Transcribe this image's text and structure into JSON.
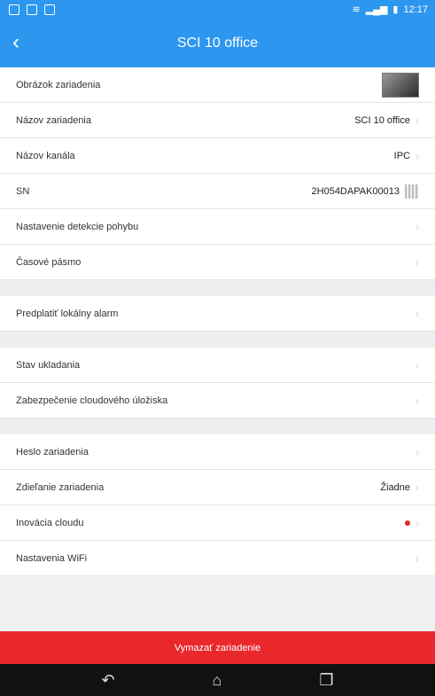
{
  "status_bar": {
    "time": "12:17"
  },
  "header": {
    "title": "SCI 10 office"
  },
  "rows": [
    {
      "label": "Obrázok zariadenia"
    },
    {
      "label": "Názov zariadenia",
      "value": "SCI 10 office"
    },
    {
      "label": "Názov kanála",
      "value": "IPC"
    },
    {
      "label": "SN",
      "value": "2H054DAPAK00013"
    },
    {
      "label": "Nastavenie detekcie pohybu"
    },
    {
      "label": "Časové pásmo"
    },
    {
      "label": "Predplatiť lokálny alarm"
    },
    {
      "label": "Stav ukladania"
    },
    {
      "label": "Zabezpečenie cloudového úložiska"
    },
    {
      "label": "Heslo zariadenia"
    },
    {
      "label": "Zdieľanie zariadenia",
      "value": "Žiadne"
    },
    {
      "label": "Inovácia cloudu"
    },
    {
      "label": "Nastavenia WiFi"
    }
  ],
  "delete_button": {
    "label": "Vymazať zariadenie"
  },
  "colors": {
    "accent": "#2d97f0",
    "danger": "#e9282b"
  }
}
